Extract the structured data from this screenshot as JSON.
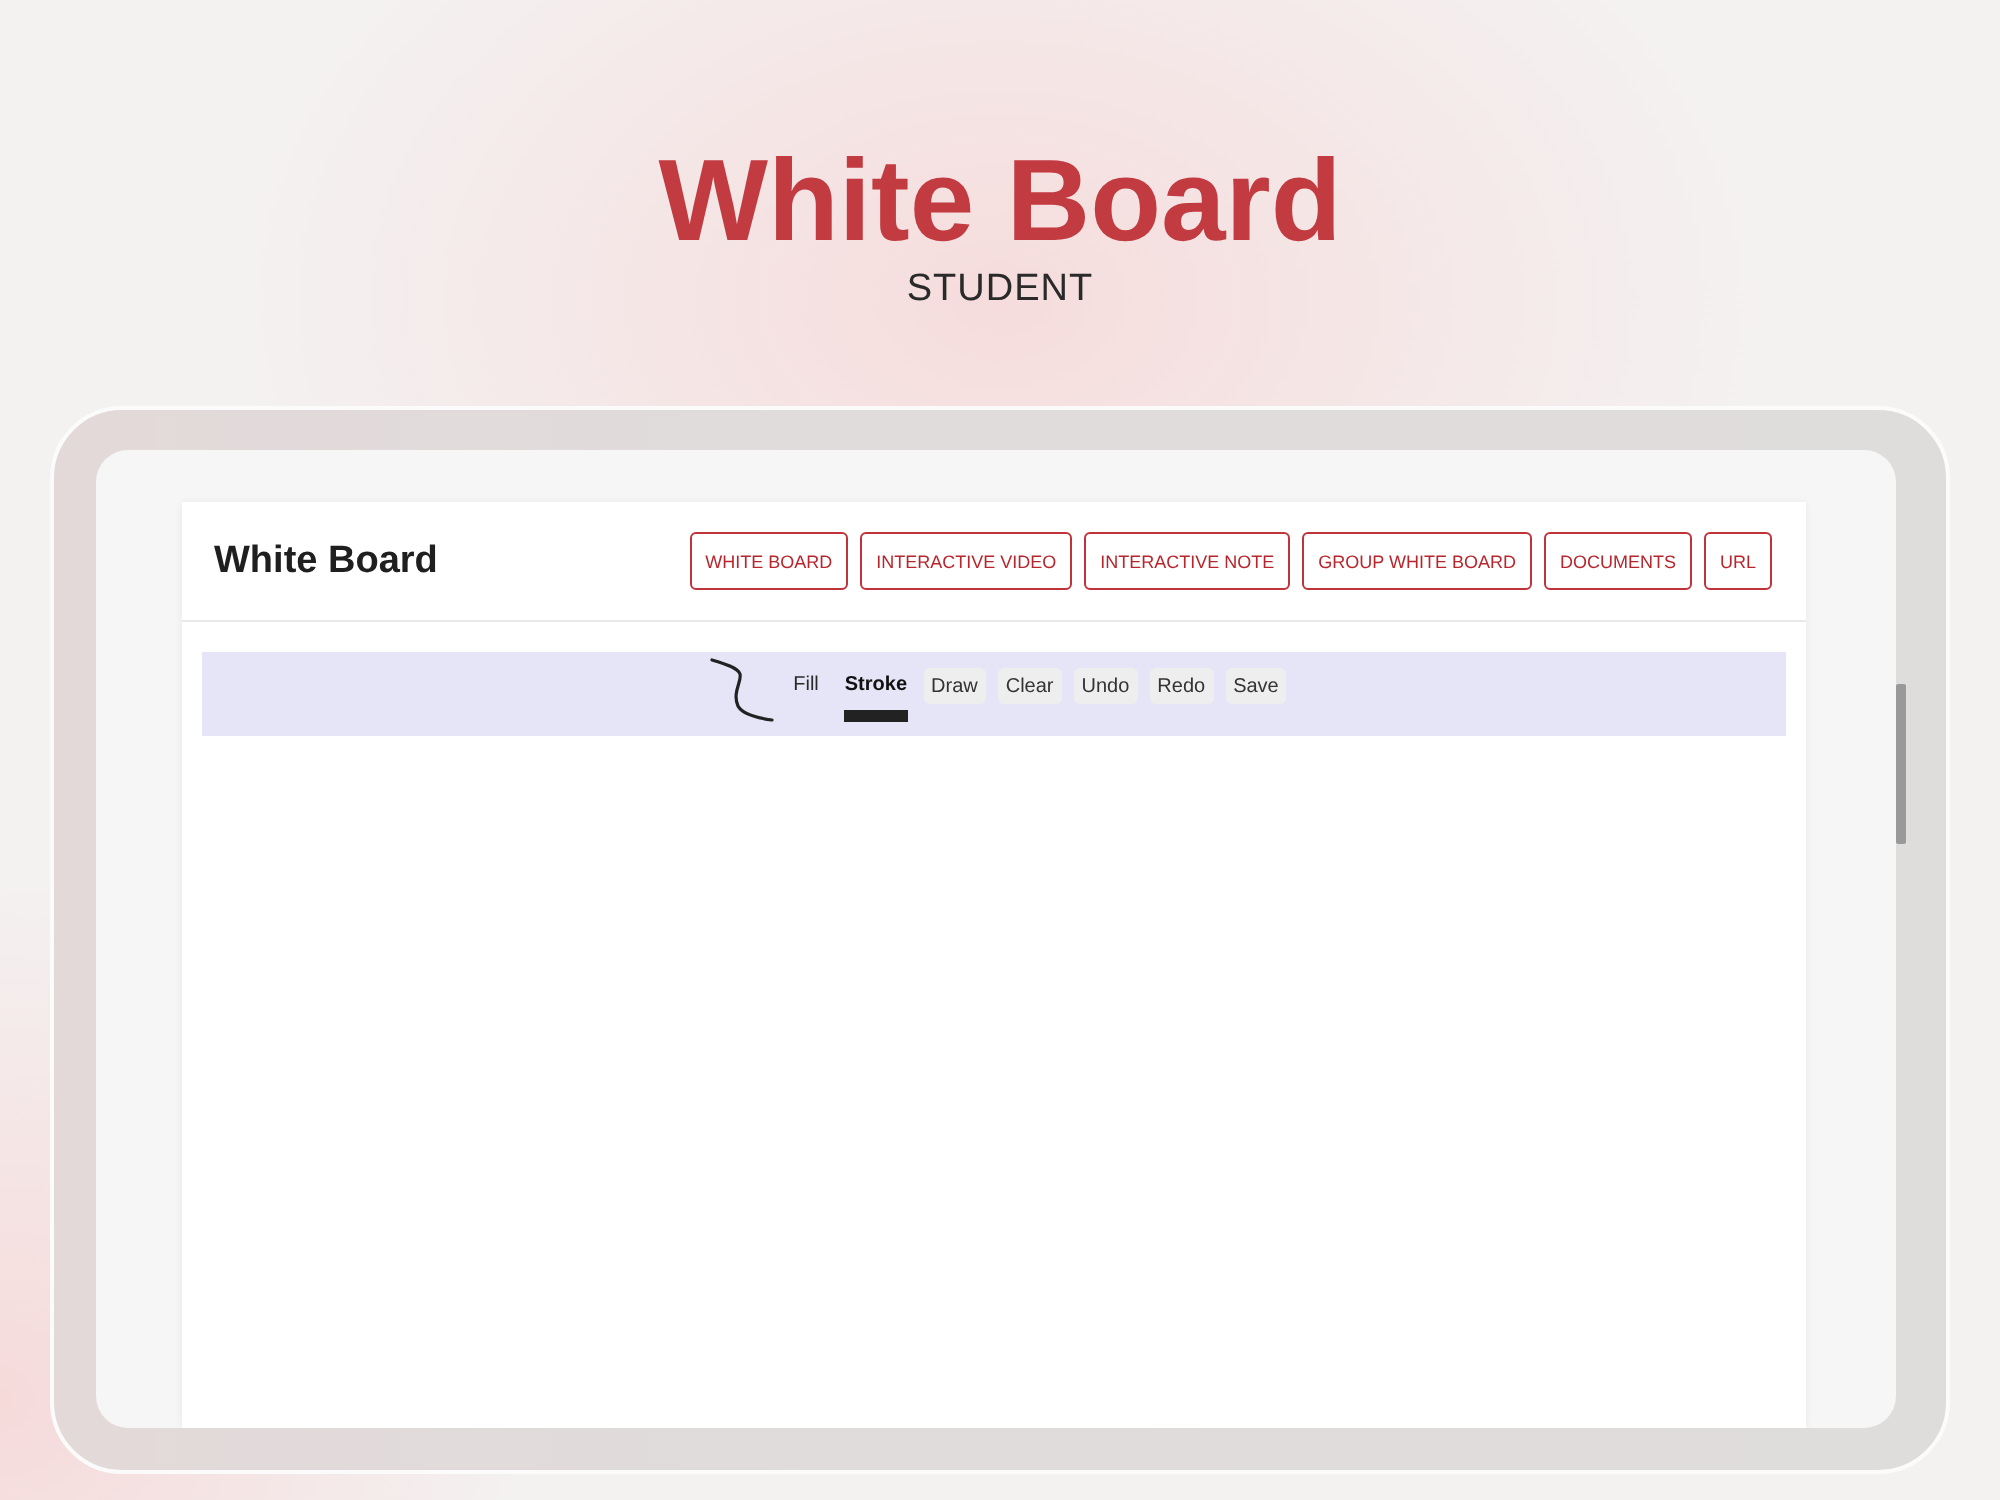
{
  "hero": {
    "title": "White Board",
    "subtitle": "STUDENT"
  },
  "app": {
    "title": "White Board",
    "nav_buttons": [
      "WHITE BOARD",
      "INTERACTIVE VIDEO",
      "INTERACTIVE NOTE",
      "GROUP WHITE BOARD",
      "DOCUMENTS",
      "URL"
    ],
    "toolbar": {
      "modes": [
        {
          "label": "Fill",
          "selected": false
        },
        {
          "label": "Stroke",
          "selected": true
        }
      ],
      "buttons": [
        "Draw",
        "Clear",
        "Undo",
        "Redo",
        "Save"
      ]
    }
  }
}
